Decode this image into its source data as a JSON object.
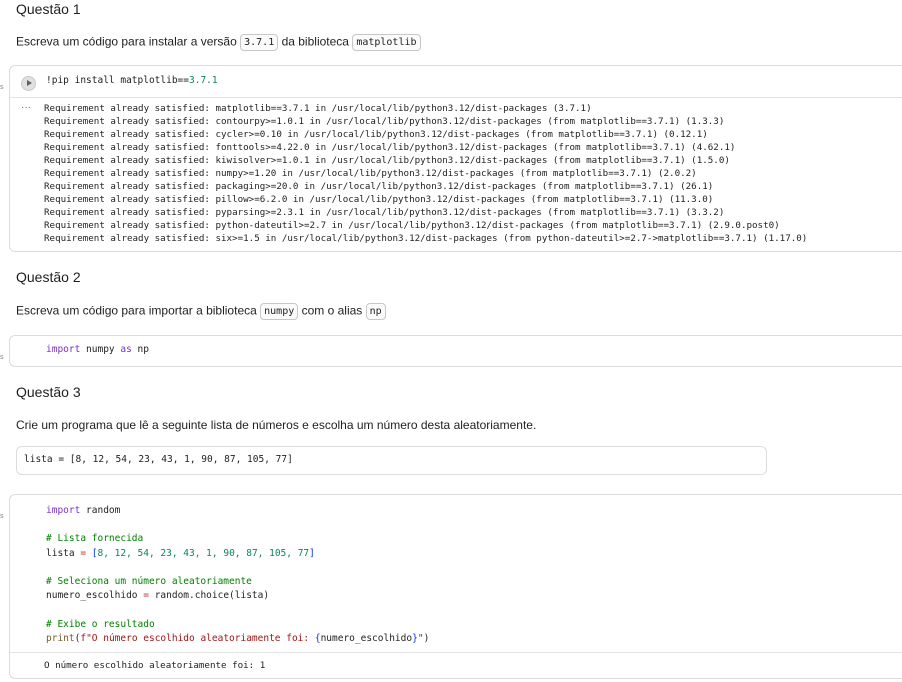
{
  "q1": {
    "heading": "Questão 1",
    "text_before": "Escreva um código para instalar a versão",
    "chip_version": "3.7.1",
    "text_mid": "da biblioteca",
    "chip_lib": "matplotlib",
    "code_cmd": "!pip install matplotlib==",
    "code_ver": "3.7.1",
    "output_lines": [
      "Requirement already satisfied: matplotlib==3.7.1 in /usr/local/lib/python3.12/dist-packages (3.7.1)",
      "Requirement already satisfied: contourpy>=1.0.1 in /usr/local/lib/python3.12/dist-packages (from matplotlib==3.7.1) (1.3.3)",
      "Requirement already satisfied: cycler>=0.10 in /usr/local/lib/python3.12/dist-packages (from matplotlib==3.7.1) (0.12.1)",
      "Requirement already satisfied: fonttools>=4.22.0 in /usr/local/lib/python3.12/dist-packages (from matplotlib==3.7.1) (4.62.1)",
      "Requirement already satisfied: kiwisolver>=1.0.1 in /usr/local/lib/python3.12/dist-packages (from matplotlib==3.7.1) (1.5.0)",
      "Requirement already satisfied: numpy>=1.20 in /usr/local/lib/python3.12/dist-packages (from matplotlib==3.7.1) (2.0.2)",
      "Requirement already satisfied: packaging>=20.0 in /usr/local/lib/python3.12/dist-packages (from matplotlib==3.7.1) (26.1)",
      "Requirement already satisfied: pillow>=6.2.0 in /usr/local/lib/python3.12/dist-packages (from matplotlib==3.7.1) (11.3.0)",
      "Requirement already satisfied: pyparsing>=2.3.1 in /usr/local/lib/python3.12/dist-packages (from matplotlib==3.7.1) (3.3.2)",
      "Requirement already satisfied: python-dateutil>=2.7 in /usr/local/lib/python3.12/dist-packages (from matplotlib==3.7.1) (2.9.0.post0)",
      "Requirement already satisfied: six>=1.5 in /usr/local/lib/python3.12/dist-packages (from python-dateutil>=2.7->matplotlib==3.7.1) (1.17.0)"
    ],
    "ellipsis": "···"
  },
  "q2": {
    "heading": "Questão 2",
    "text_before": "Escreva um código para importar a biblioteca",
    "chip_lib": "numpy",
    "text_mid": "com o alias",
    "chip_alias": "np",
    "code_kw_import": "import",
    "code_mod": " numpy ",
    "code_kw_as": "as",
    "code_alias": " np"
  },
  "q3": {
    "heading": "Questão 3",
    "text": "Crie um programa que lê a seguinte lista de números e escolha um número desta aleatoriamente.",
    "list_line": "lista = [8, 12, 54, 23, 43, 1, 90, 87, 105, 77]",
    "code": {
      "line1_kw": "import",
      "line1_rest": " random",
      "comment1": "# Lista fornecida",
      "list_var": "lista ",
      "list_eq": "=",
      "list_open": " [",
      "list_nums": "8, 12, 54, 23, 43, 1, 90, 87, 105, 77",
      "list_close": "]",
      "comment2": "# Seleciona um número aleatoriamente",
      "choice_var": "numero_escolhido ",
      "choice_eq": "=",
      "choice_call": " random.choice(",
      "choice_arg": "lista",
      "choice_close": ")",
      "comment3": "# Exibe o resultado",
      "print_fn": "print",
      "print_open": "(",
      "print_str_start": "f\"O número escolhido aleatoriamente foi: ",
      "print_brace_open": "{",
      "print_var": "numero_escolhido",
      "print_brace_close": "}",
      "print_str_end": "\"",
      "print_close": ")"
    },
    "output": "O número escolhido aleatoriamente foi: 1"
  },
  "gutter_mark": "s"
}
